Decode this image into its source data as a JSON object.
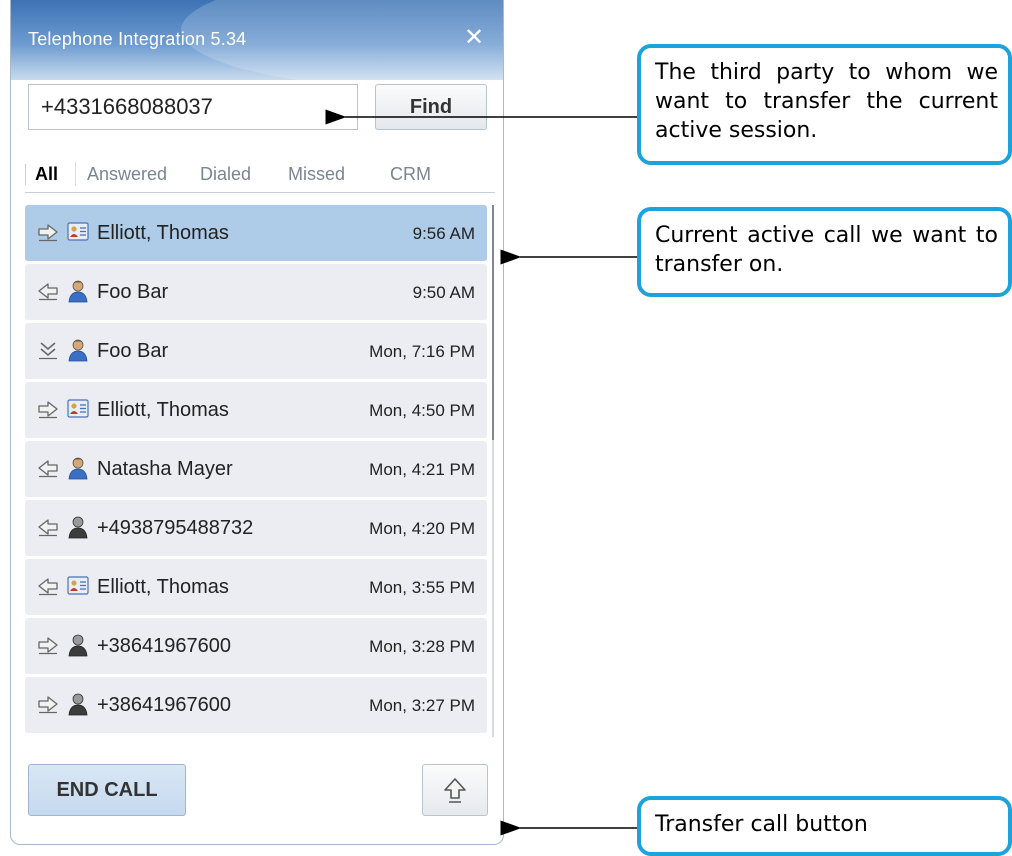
{
  "window": {
    "title": "Telephone Integration 5.34",
    "close_glyph": "✕"
  },
  "search": {
    "value": "+4331668088037",
    "find_label": "Find"
  },
  "tabs": [
    {
      "label": "All",
      "active": true
    },
    {
      "label": "Answered",
      "active": false
    },
    {
      "label": "Dialed",
      "active": false
    },
    {
      "label": "Missed",
      "active": false
    },
    {
      "label": "CRM",
      "active": false
    }
  ],
  "calls": [
    {
      "direction": "outgoing-arrow-icon",
      "contact_icon": "contact-card-icon",
      "name": "Elliott, Thomas",
      "time": "9:56 AM",
      "active": true
    },
    {
      "direction": "incoming-arrow-icon",
      "contact_icon": "person-blue-icon",
      "name": "Foo Bar",
      "time": "9:50 AM",
      "active": false
    },
    {
      "direction": "missed-call-icon",
      "contact_icon": "person-blue-icon",
      "name": "Foo Bar",
      "time": "Mon, 7:16 PM",
      "active": false
    },
    {
      "direction": "outgoing-arrow-icon",
      "contact_icon": "contact-card-icon",
      "name": "Elliott, Thomas",
      "time": "Mon, 4:50 PM",
      "active": false
    },
    {
      "direction": "incoming-arrow-icon",
      "contact_icon": "person-blue-icon",
      "name": "Natasha Mayer",
      "time": "Mon, 4:21 PM",
      "active": false
    },
    {
      "direction": "incoming-arrow-icon",
      "contact_icon": "person-dark-icon",
      "name": "+4938795488732",
      "time": "Mon, 4:20 PM",
      "active": false
    },
    {
      "direction": "incoming-arrow-icon",
      "contact_icon": "contact-card-icon",
      "name": "Elliott, Thomas",
      "time": "Mon, 3:55 PM",
      "active": false
    },
    {
      "direction": "outgoing-arrow-icon",
      "contact_icon": "person-dark-icon",
      "name": "+38641967600",
      "time": "Mon, 3:28 PM",
      "active": false
    },
    {
      "direction": "outgoing-arrow-icon",
      "contact_icon": "person-dark-icon",
      "name": "+38641967600",
      "time": "Mon, 3:27 PM",
      "active": false
    }
  ],
  "footer": {
    "end_call_label": "END CALL",
    "transfer_icon": "transfer-up-arrow-icon"
  },
  "annotations": {
    "third_party": "The third party to whom we want to transfer the current active session.",
    "active_call": "Current active call we want to transfer on.",
    "transfer_button": "Transfer call button"
  },
  "colors": {
    "title_bar": "#3c73b4",
    "active_row": "#aecbe8",
    "row": "#ebedf2",
    "callout_border": "#1da2dc",
    "end_call_button": "#c5d9ee"
  }
}
